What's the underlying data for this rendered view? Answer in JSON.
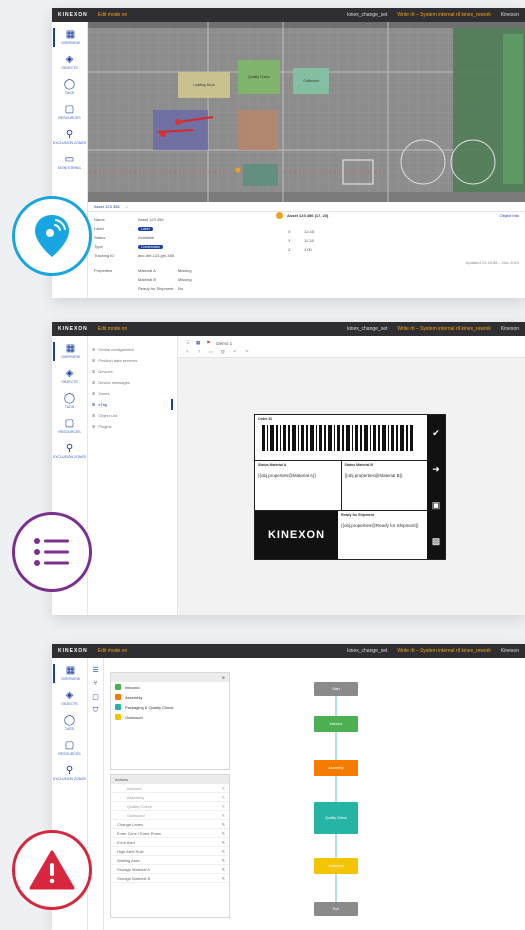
{
  "brand": "KINEXON",
  "topbar": {
    "edit_mode": "Edit mode on",
    "config_file": "kinex_change_set",
    "write_status": "Write rtl – System internal rtl kinex_rework",
    "user": "Kinexon"
  },
  "sidebar": {
    "items": [
      {
        "label": "Overview",
        "icon": "map-icon"
      },
      {
        "label": "Objects",
        "icon": "tag-icon"
      },
      {
        "label": "Tags",
        "icon": "circle-icon"
      },
      {
        "label": "Resources",
        "icon": "square-icon"
      },
      {
        "label": "Exclusion Zones",
        "icon": "pin-icon"
      },
      {
        "label": "Monitoring",
        "icon": "monitor-icon"
      }
    ]
  },
  "panel1": {
    "zones": [
      "Loading Dock",
      "Quality Check",
      "Outbound"
    ],
    "details_tab": "Asset 123 456",
    "fields": [
      {
        "key": "Name",
        "value": "Asset 123 456"
      },
      {
        "key": "Label",
        "value": "Label"
      },
      {
        "key": "Status",
        "value": "Available"
      },
      {
        "key": "Type",
        "value": "Commission"
      },
      {
        "key": "Tracking ID",
        "value": "abc-def-123-ghi-456"
      }
    ],
    "properties_label": "Properties",
    "properties": [
      {
        "key": "Material A",
        "value": "Missing"
      },
      {
        "key": "Material B",
        "value": "Missing"
      },
      {
        "key": "Ready for Shipment",
        "value": "No"
      }
    ],
    "position_title": "Asset 123 456 (17, 23)",
    "position_link": "Object Info",
    "coords": [
      {
        "axis": "X",
        "value": "12.45"
      },
      {
        "axis": "Y",
        "value": "11.28"
      },
      {
        "axis": "Z",
        "value": "1.00"
      }
    ],
    "last_update": "Updated 12:34:56 – Nov 2023"
  },
  "panel2": {
    "tree": [
      "Global configuration",
      "Position data services",
      "Devices",
      "Device messages",
      "Zones",
      "eTag",
      "Object List",
      "Plugins"
    ],
    "breadcrumb": "Demo 1",
    "label_title": "Order ID",
    "cell1_title": "Status Material A",
    "cell1_value": "{{obj.properties@Material A}}",
    "cell2_title": "Status Material B",
    "cell2_value": "{{obj.properties@Material B}}",
    "logo_text": "KINEXON",
    "cell3_title": "Ready for Shipment",
    "cell3_value": "{{obj.properties@Ready for Shipment}}"
  },
  "panel3": {
    "statuses": [
      {
        "name": "Inbound",
        "color": "#4caf50"
      },
      {
        "name": "Assembly",
        "color": "#f57c00"
      },
      {
        "name": "Packaging & Quality Check",
        "color": "#26b5a5"
      },
      {
        "name": "Outbound",
        "color": "#f5c400"
      }
    ],
    "actions_header": "Actions",
    "actions": [
      {
        "name": "Inbound",
        "sub": true
      },
      {
        "name": "Assembly",
        "sub": true
      },
      {
        "name": "Quality Check",
        "sub": true
      },
      {
        "name": "Outbound",
        "sub": true
      },
      {
        "name": "Change Lanes",
        "sub": false
      },
      {
        "name": "Enter Zone / Enter Rules",
        "sub": false
      },
      {
        "name": "Error Alert",
        "sub": false
      },
      {
        "name": "High Alert Rule",
        "sub": false
      },
      {
        "name": "Waiting Area",
        "sub": false
      },
      {
        "name": "Storage Material A",
        "sub": false
      },
      {
        "name": "Storage Material B",
        "sub": false
      }
    ],
    "flow": [
      {
        "label": "Start",
        "color": "#8a8a8a"
      },
      {
        "label": "Inbound",
        "color": "#4caf50"
      },
      {
        "label": "Assembly",
        "color": "#f57c00"
      },
      {
        "label": "Quality Check",
        "color": "#26b5a5"
      },
      {
        "label": "Outbound",
        "color": "#f5c400"
      },
      {
        "label": "End",
        "color": "#8a8a8a"
      }
    ]
  },
  "colors": {
    "location_badge": "#18a6e2",
    "list_badge": "#7b2f8e",
    "warning_badge": "#d7263d",
    "accent": "#1a3fa0"
  }
}
